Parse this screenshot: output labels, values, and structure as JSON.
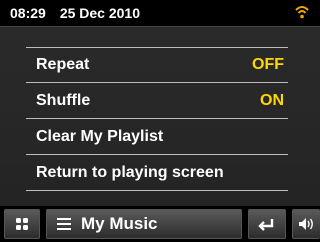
{
  "status": {
    "time": "08:29",
    "date": "25 Dec 2010",
    "wifi_icon": "wifi-icon",
    "wifi_color": "#f0a500"
  },
  "menu": {
    "items": [
      {
        "label": "Repeat",
        "value": "OFF"
      },
      {
        "label": "Shuffle",
        "value": "ON"
      },
      {
        "label": "Clear My Playlist",
        "value": ""
      },
      {
        "label": "Return to playing screen",
        "value": ""
      }
    ],
    "value_color": "#ffd800"
  },
  "bottombar": {
    "title": "My Music",
    "home_icon": "grid-icon",
    "menu_icon": "hamburger-icon",
    "back_icon": "back-arrow-icon",
    "volume_icon": "speaker-icon"
  }
}
